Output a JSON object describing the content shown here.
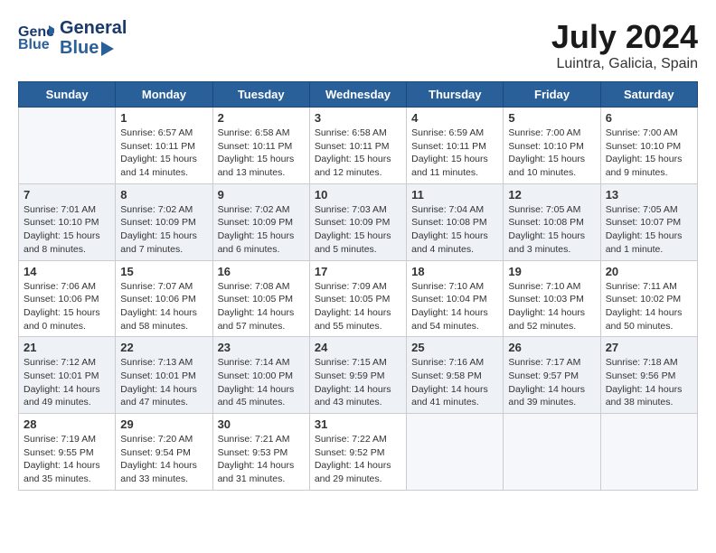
{
  "header": {
    "logo": {
      "general": "General",
      "blue": "Blue"
    },
    "title": "July 2024",
    "location": "Luintra, Galicia, Spain"
  },
  "weekdays": [
    "Sunday",
    "Monday",
    "Tuesday",
    "Wednesday",
    "Thursday",
    "Friday",
    "Saturday"
  ],
  "weeks": [
    [
      {
        "day": "",
        "empty": true
      },
      {
        "day": "1",
        "sunrise": "Sunrise: 6:57 AM",
        "sunset": "Sunset: 10:11 PM",
        "daylight": "Daylight: 15 hours and 14 minutes."
      },
      {
        "day": "2",
        "sunrise": "Sunrise: 6:58 AM",
        "sunset": "Sunset: 10:11 PM",
        "daylight": "Daylight: 15 hours and 13 minutes."
      },
      {
        "day": "3",
        "sunrise": "Sunrise: 6:58 AM",
        "sunset": "Sunset: 10:11 PM",
        "daylight": "Daylight: 15 hours and 12 minutes."
      },
      {
        "day": "4",
        "sunrise": "Sunrise: 6:59 AM",
        "sunset": "Sunset: 10:11 PM",
        "daylight": "Daylight: 15 hours and 11 minutes."
      },
      {
        "day": "5",
        "sunrise": "Sunrise: 7:00 AM",
        "sunset": "Sunset: 10:10 PM",
        "daylight": "Daylight: 15 hours and 10 minutes."
      },
      {
        "day": "6",
        "sunrise": "Sunrise: 7:00 AM",
        "sunset": "Sunset: 10:10 PM",
        "daylight": "Daylight: 15 hours and 9 minutes."
      }
    ],
    [
      {
        "day": "7",
        "sunrise": "Sunrise: 7:01 AM",
        "sunset": "Sunset: 10:10 PM",
        "daylight": "Daylight: 15 hours and 8 minutes."
      },
      {
        "day": "8",
        "sunrise": "Sunrise: 7:02 AM",
        "sunset": "Sunset: 10:09 PM",
        "daylight": "Daylight: 15 hours and 7 minutes."
      },
      {
        "day": "9",
        "sunrise": "Sunrise: 7:02 AM",
        "sunset": "Sunset: 10:09 PM",
        "daylight": "Daylight: 15 hours and 6 minutes."
      },
      {
        "day": "10",
        "sunrise": "Sunrise: 7:03 AM",
        "sunset": "Sunset: 10:09 PM",
        "daylight": "Daylight: 15 hours and 5 minutes."
      },
      {
        "day": "11",
        "sunrise": "Sunrise: 7:04 AM",
        "sunset": "Sunset: 10:08 PM",
        "daylight": "Daylight: 15 hours and 4 minutes."
      },
      {
        "day": "12",
        "sunrise": "Sunrise: 7:05 AM",
        "sunset": "Sunset: 10:08 PM",
        "daylight": "Daylight: 15 hours and 3 minutes."
      },
      {
        "day": "13",
        "sunrise": "Sunrise: 7:05 AM",
        "sunset": "Sunset: 10:07 PM",
        "daylight": "Daylight: 15 hours and 1 minute."
      }
    ],
    [
      {
        "day": "14",
        "sunrise": "Sunrise: 7:06 AM",
        "sunset": "Sunset: 10:06 PM",
        "daylight": "Daylight: 15 hours and 0 minutes."
      },
      {
        "day": "15",
        "sunrise": "Sunrise: 7:07 AM",
        "sunset": "Sunset: 10:06 PM",
        "daylight": "Daylight: 14 hours and 58 minutes."
      },
      {
        "day": "16",
        "sunrise": "Sunrise: 7:08 AM",
        "sunset": "Sunset: 10:05 PM",
        "daylight": "Daylight: 14 hours and 57 minutes."
      },
      {
        "day": "17",
        "sunrise": "Sunrise: 7:09 AM",
        "sunset": "Sunset: 10:05 PM",
        "daylight": "Daylight: 14 hours and 55 minutes."
      },
      {
        "day": "18",
        "sunrise": "Sunrise: 7:10 AM",
        "sunset": "Sunset: 10:04 PM",
        "daylight": "Daylight: 14 hours and 54 minutes."
      },
      {
        "day": "19",
        "sunrise": "Sunrise: 7:10 AM",
        "sunset": "Sunset: 10:03 PM",
        "daylight": "Daylight: 14 hours and 52 minutes."
      },
      {
        "day": "20",
        "sunrise": "Sunrise: 7:11 AM",
        "sunset": "Sunset: 10:02 PM",
        "daylight": "Daylight: 14 hours and 50 minutes."
      }
    ],
    [
      {
        "day": "21",
        "sunrise": "Sunrise: 7:12 AM",
        "sunset": "Sunset: 10:01 PM",
        "daylight": "Daylight: 14 hours and 49 minutes."
      },
      {
        "day": "22",
        "sunrise": "Sunrise: 7:13 AM",
        "sunset": "Sunset: 10:01 PM",
        "daylight": "Daylight: 14 hours and 47 minutes."
      },
      {
        "day": "23",
        "sunrise": "Sunrise: 7:14 AM",
        "sunset": "Sunset: 10:00 PM",
        "daylight": "Daylight: 14 hours and 45 minutes."
      },
      {
        "day": "24",
        "sunrise": "Sunrise: 7:15 AM",
        "sunset": "Sunset: 9:59 PM",
        "daylight": "Daylight: 14 hours and 43 minutes."
      },
      {
        "day": "25",
        "sunrise": "Sunrise: 7:16 AM",
        "sunset": "Sunset: 9:58 PM",
        "daylight": "Daylight: 14 hours and 41 minutes."
      },
      {
        "day": "26",
        "sunrise": "Sunrise: 7:17 AM",
        "sunset": "Sunset: 9:57 PM",
        "daylight": "Daylight: 14 hours and 39 minutes."
      },
      {
        "day": "27",
        "sunrise": "Sunrise: 7:18 AM",
        "sunset": "Sunset: 9:56 PM",
        "daylight": "Daylight: 14 hours and 38 minutes."
      }
    ],
    [
      {
        "day": "28",
        "sunrise": "Sunrise: 7:19 AM",
        "sunset": "Sunset: 9:55 PM",
        "daylight": "Daylight: 14 hours and 35 minutes."
      },
      {
        "day": "29",
        "sunrise": "Sunrise: 7:20 AM",
        "sunset": "Sunset: 9:54 PM",
        "daylight": "Daylight: 14 hours and 33 minutes."
      },
      {
        "day": "30",
        "sunrise": "Sunrise: 7:21 AM",
        "sunset": "Sunset: 9:53 PM",
        "daylight": "Daylight: 14 hours and 31 minutes."
      },
      {
        "day": "31",
        "sunrise": "Sunrise: 7:22 AM",
        "sunset": "Sunset: 9:52 PM",
        "daylight": "Daylight: 14 hours and 29 minutes."
      },
      {
        "day": "",
        "empty": true
      },
      {
        "day": "",
        "empty": true
      },
      {
        "day": "",
        "empty": true
      }
    ]
  ]
}
